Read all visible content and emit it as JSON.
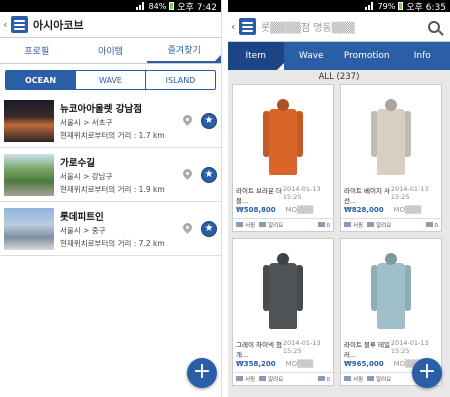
{
  "left": {
    "status": {
      "battery": "84%",
      "time": "오후 7:42"
    },
    "header": {
      "title": "아시아코브"
    },
    "tabs": [
      {
        "label": "프로필"
      },
      {
        "label": "아이템"
      },
      {
        "label": "즐겨찾기"
      }
    ],
    "segments": [
      {
        "label": "OCEAN"
      },
      {
        "label": "WAVE"
      },
      {
        "label": "ISLAND"
      }
    ],
    "stores": [
      {
        "name": "뉴코아아울렛 강남점",
        "location": "서울시 > 서초구",
        "distance": "현재위치로부터의 거리 : 1.7 km"
      },
      {
        "name": "가로수길",
        "location": "서울시 > 강남구",
        "distance": "현재위치로부터의 거리 : 1.9 km"
      },
      {
        "name": "롯데피트인",
        "location": "서울시 > 중구",
        "distance": "현재위치로부터의 거리 : 7.2 km"
      }
    ],
    "fab": "+"
  },
  "right": {
    "status": {
      "battery": "79%",
      "time": "오후 6:35"
    },
    "header": {
      "title": "롯▒▒▒▒점 명동▒▒▒"
    },
    "tabs": [
      {
        "label": "Item"
      },
      {
        "label": "Wave"
      },
      {
        "label": "Promotion"
      },
      {
        "label": "Info"
      }
    ],
    "count_label": "ALL (237)",
    "products": [
      {
        "name": "라이트 브라운 더블...",
        "date": "2014-01-13 15:25",
        "price": "₩508,800",
        "shop": "MO▒▒▒",
        "a": "서핑",
        "b": "알려요",
        "c": "0",
        "color": "#d9652a"
      },
      {
        "name": "라이트 베이지 사선...",
        "date": "2014-01-13 15:25",
        "price": "₩828,000",
        "shop": "MO▒▒▒",
        "a": "서핑",
        "b": "알려요",
        "c": "0",
        "color": "#d6cfc2"
      },
      {
        "name": "그레이 하이넥 첨개...",
        "date": "2014-01-13 15:25",
        "price": "₩358,200",
        "shop": "MO▒▒▒",
        "a": "서핑",
        "b": "알려요",
        "c": "0",
        "color": "#4f5356"
      },
      {
        "name": "라이트 블루 테일러...",
        "date": "2014-01-13 15:25",
        "price": "₩965,000",
        "shop": "MO▒▒▒",
        "a": "서핑",
        "b": "알려요",
        "c": "0",
        "color": "#9fc0c8"
      }
    ],
    "fab": "+"
  },
  "colors": {
    "accent": "#2a5fa8",
    "accent_dark": "#1c4585"
  }
}
